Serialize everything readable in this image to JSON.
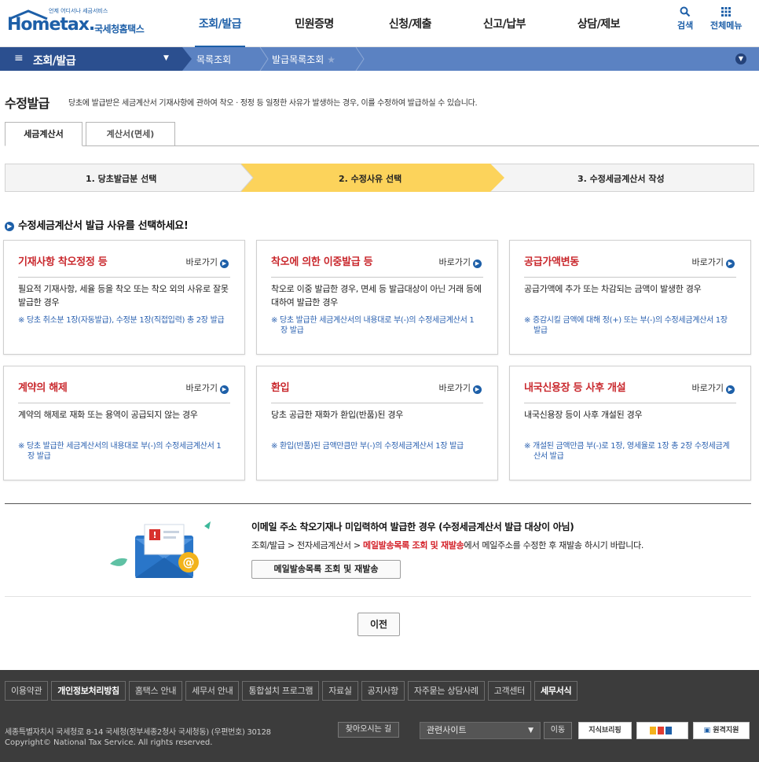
{
  "header": {
    "logo_tagline": "언제 어디서나 세금서비스",
    "logo_word": "Hometax.",
    "logo_kr": "국세청홈택스",
    "nav": [
      "조회/발급",
      "민원증명",
      "신청/제출",
      "신고/납부",
      "상담/제보"
    ],
    "search_label": "검색",
    "allmenu_label": "전체메뉴"
  },
  "location": {
    "current_menu": "조회/발급",
    "crumbs": [
      "목록조회",
      "발급목록조회"
    ]
  },
  "page": {
    "title": "수정발급",
    "description": "당초에 발급받은 세금계산서 기재사항에 관하여 착오 · 정정 등 일정한 사유가 발생하는 경우, 이를 수정하여 발급하실 수 있습니다."
  },
  "tabs": [
    "세금계산서",
    "계산서(면세)"
  ],
  "steps": [
    "1. 당초발급분 선택",
    "2. 수정사유 선택",
    "3. 수정세금계산서 작성"
  ],
  "section_title": "수정세금계산서 발급 사유를 선택하세요!",
  "shortcut_label": "바로가기",
  "cards": [
    {
      "title": "기재사항 착오정정 등",
      "desc": "필요적 기재사항, 세율 등을 착오 또는 착오 외의 사유로 잘못 발급한 경우",
      "note": "※ 당초 취소분 1장(자동발급), 수정분 1장(직접입력) 총 2장 발급"
    },
    {
      "title": "착오에 의한 이중발급 등",
      "desc": "착오로 이중 발급한 경우, 면세 등 발급대상이 아닌 거래 등에 대하여 발급한 경우",
      "note": "※ 당초 발급한 세금계산서의 내용대로 부(-)의 수정세금계산서 1장 발급"
    },
    {
      "title": "공급가액변동",
      "desc": "공급가액에 추가 또는 차감되는 금액이 발생한 경우",
      "note": "※ 증감시킬 금액에 대해 정(+) 또는 부(-)의 수정세금계산서 1장 발급"
    },
    {
      "title": "계약의 해제",
      "desc": "계약의 해제로 재화 또는 용역이 공급되지 않는 경우",
      "note": "※ 당초 발급한 세금계산서의 내용대로 부(-)의 수정세금계산서 1장 발급"
    },
    {
      "title": "환입",
      "desc": "당초 공급한 재화가 환입(반품)된 경우",
      "note": "※ 환입(반품)된 금액만큼만 부(-)의 수정세금계산서 1장 발급"
    },
    {
      "title": "내국신용장 등 사후 개설",
      "desc": "내국신용장 등이 사후 개설된 경우",
      "note": "※ 개설된 금액만큼 부(-)로 1장, 영세율로 1장 총 2장 수정세금계산서 발급"
    }
  ],
  "email_notice": {
    "title": "이메일 주소 착오기재나 미입력하여 발급한 경우 (수정세금계산서 발급 대상이 아님)",
    "path_prefix": "조회/발급 > 전자세금계산서 > ",
    "path_highlight": "메일발송목록 조회 및 재발송",
    "path_suffix": "에서 메일주소를 수정한 후 재발송 하시기 바랍니다.",
    "button": "메일발송목록 조회 및 재발송"
  },
  "prev_button": "이전",
  "footer": {
    "links": [
      "이용약관",
      "개인정보처리방침",
      "홈택스 안내",
      "세무서 안내",
      "통합설치 프로그램",
      "자료실",
      "공지사항",
      "자주묻는 상담사례",
      "고객센터",
      "세무서식"
    ],
    "address": "세종특별자치시 국세청로 8-14 국세청(정부세종2청사 국세청동) (우편번호) 30128",
    "directions": "찾아오시는 길",
    "copyright": "Copyright© National Tax Service. All rights reserved.",
    "related_sites": "관련사이트",
    "go_button": "이동",
    "banner1": "지식브리핑",
    "banner2": "",
    "remote_support": "원격지원"
  },
  "colors": {
    "brand": "#1d5fa8",
    "accent_red": "#c9282d",
    "step_active": "#fcd35b",
    "footer_bg": "#3c3c3c"
  }
}
